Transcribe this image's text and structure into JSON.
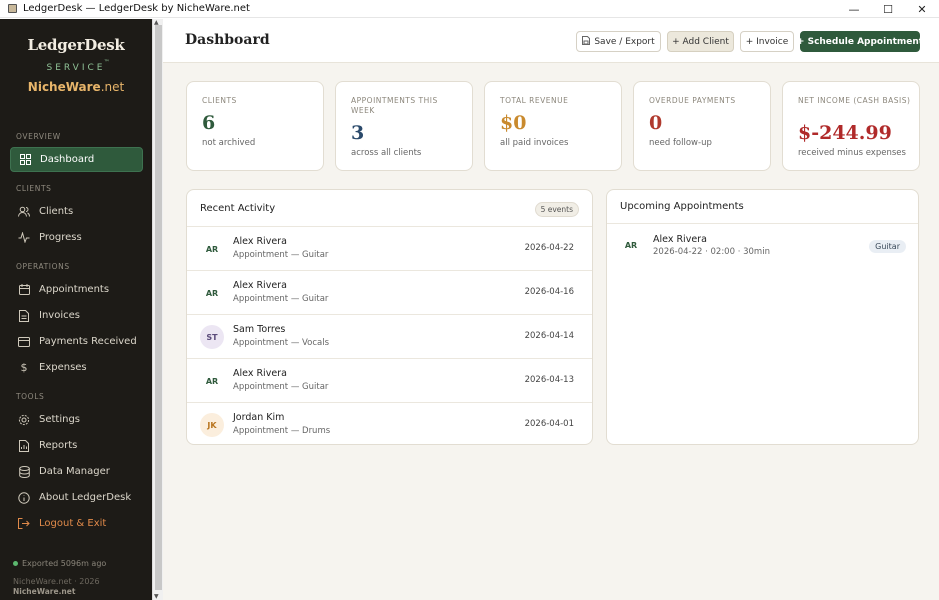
{
  "window": {
    "title": "LedgerDesk — LedgerDesk by NicheWare.net",
    "minimize": "—",
    "maximize": "☐",
    "close": "✕"
  },
  "brand": {
    "name": "LedgerDesk",
    "service": "SERVICE",
    "tm": "™",
    "nw_main": "NicheWare",
    "nw_tld": ".net"
  },
  "sidebar": {
    "sections": {
      "overview": "OVERVIEW",
      "clients": "CLIENTS",
      "operations": "OPERATIONS",
      "tools": "TOOLS"
    },
    "items": {
      "dashboard": "Dashboard",
      "clients": "Clients",
      "progress": "Progress",
      "appointments": "Appointments",
      "invoices": "Invoices",
      "payments": "Payments Received",
      "expenses": "Expenses",
      "settings": "Settings",
      "reports": "Reports",
      "data_manager": "Data Manager",
      "about": "About LedgerDesk",
      "logout": "Logout & Exit"
    },
    "footer": {
      "exported": "Exported 5096m ago",
      "copyright": "NicheWare.net · 2026",
      "logo": "NicheWare.net"
    }
  },
  "header": {
    "title": "Dashboard",
    "save_export": "Save / Export",
    "add_client": "+ Add Client",
    "invoice": "+ Invoice",
    "schedule": "+ Schedule Appointment"
  },
  "stats": [
    {
      "label": "CLIENTS",
      "value": "6",
      "sub": "not archived",
      "color": "#2f5a3c"
    },
    {
      "label": "APPOINTMENTS THIS WEEK",
      "value": "3",
      "sub": "across all clients",
      "color": "#2b4a6b"
    },
    {
      "label": "TOTAL REVENUE",
      "value": "$0",
      "sub": "all paid invoices",
      "color": "#c98a2e"
    },
    {
      "label": "OVERDUE PAYMENTS",
      "value": "0",
      "sub": "need follow-up",
      "color": "#b03a2e"
    },
    {
      "label": "NET INCOME (CASH BASIS)",
      "value": "$-244.99",
      "sub": "received minus expenses",
      "color": "#b02a2a"
    }
  ],
  "recent": {
    "title": "Recent Activity",
    "badge": "5 events",
    "rows": [
      {
        "initials": "AR",
        "name": "Alex Rivera",
        "sub": "Appointment — Guitar",
        "date": "2026-04-22"
      },
      {
        "initials": "AR",
        "name": "Alex Rivera",
        "sub": "Appointment — Guitar",
        "date": "2026-04-16"
      },
      {
        "initials": "ST",
        "name": "Sam Torres",
        "sub": "Appointment — Vocals",
        "date": "2026-04-14"
      },
      {
        "initials": "AR",
        "name": "Alex Rivera",
        "sub": "Appointment — Guitar",
        "date": "2026-04-13"
      },
      {
        "initials": "JK",
        "name": "Jordan Kim",
        "sub": "Appointment — Drums",
        "date": "2026-04-01"
      }
    ]
  },
  "upcoming": {
    "title": "Upcoming Appointments",
    "rows": [
      {
        "initials": "AR",
        "name": "Alex Rivera",
        "sub": "2026-04-22 · 02:00 · 30min",
        "tag": "Guitar"
      }
    ]
  }
}
